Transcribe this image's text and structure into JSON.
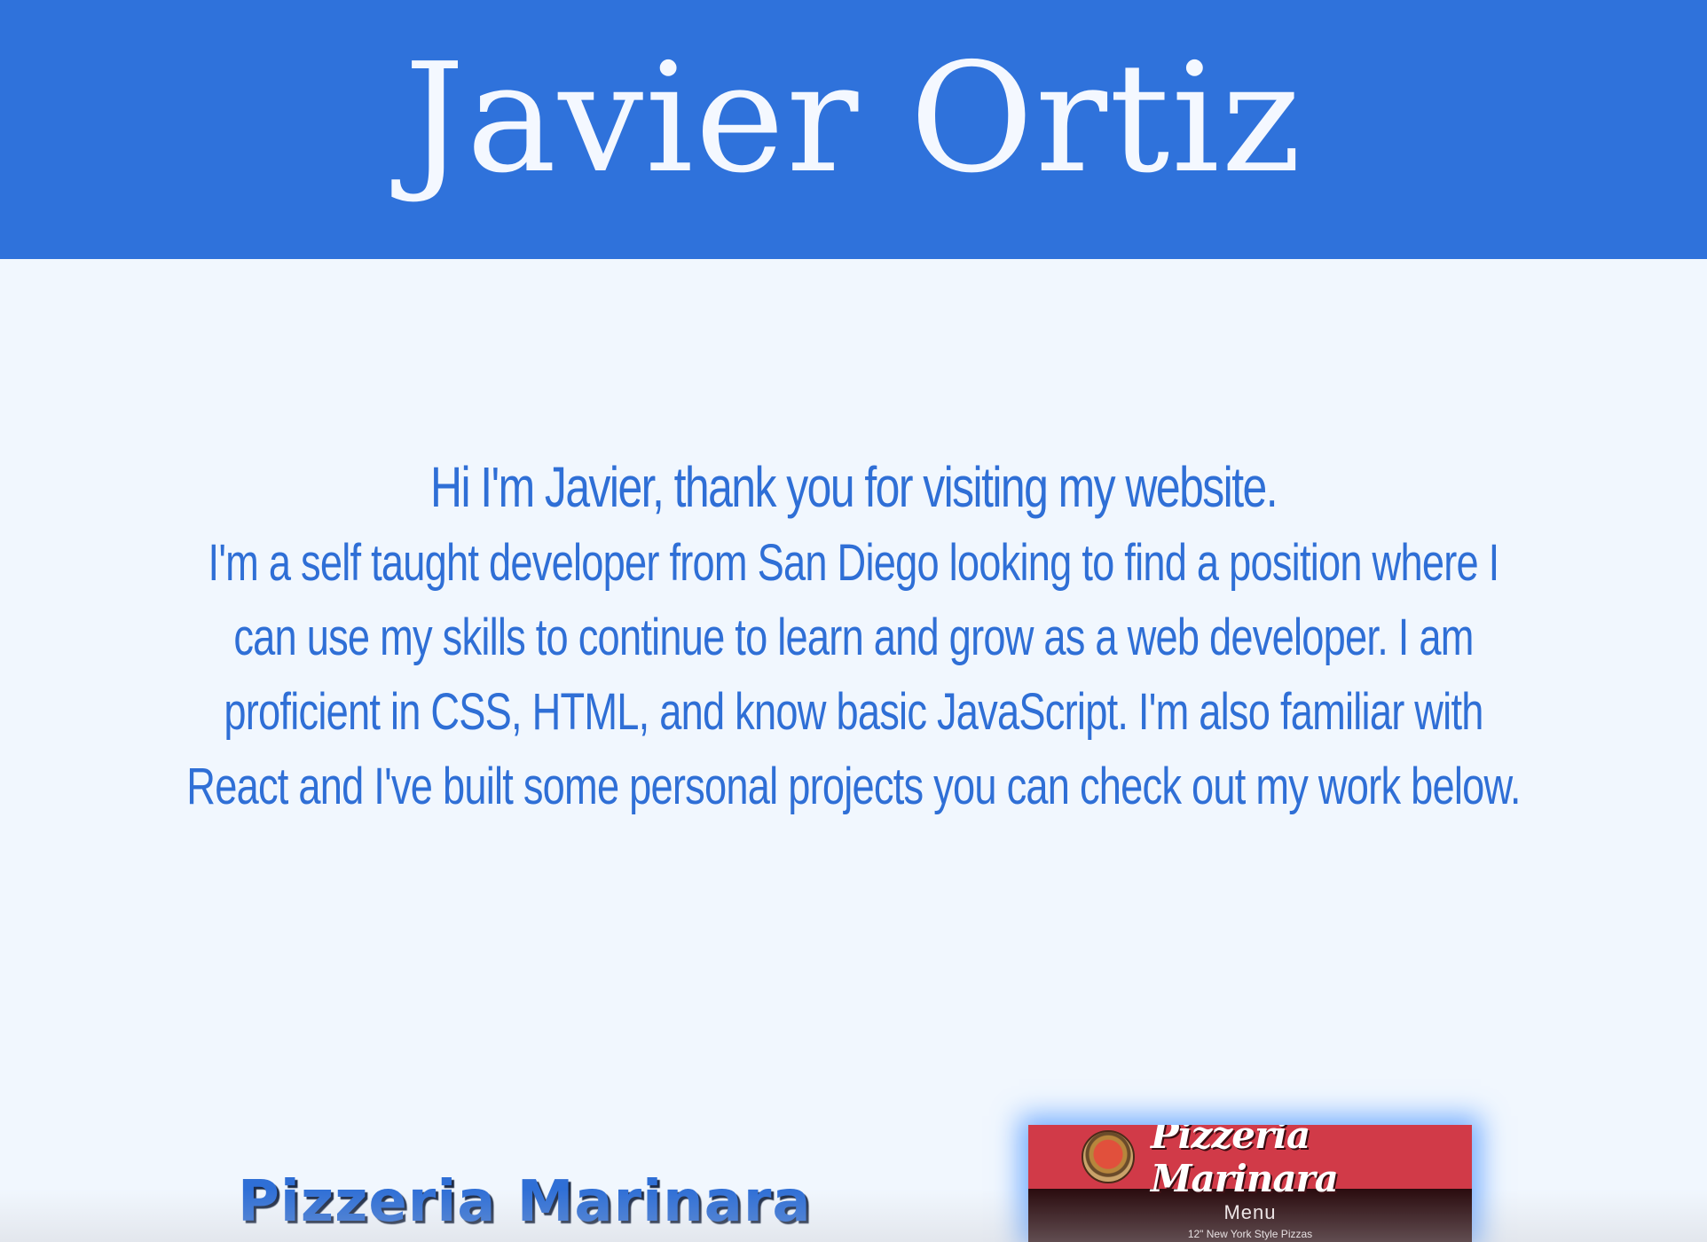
{
  "header": {
    "title": "Javier Ortiz"
  },
  "intro": {
    "greeting": "Hi I'm Javier, thank you for visiting my website.",
    "bio": "I'm a self taught developer from San Diego looking to find a position where I can use my skills to continue to learn and grow as a web developer. I am proficient in CSS, HTML, and know basic JavaScript. I'm also familiar with React and I've built some personal projects you can check out my work below."
  },
  "projects": [
    {
      "title": "Pizzeria Marinara",
      "preview": {
        "brand": "Pizzeria Marinara",
        "menu_title": "Menu",
        "menu_subtitle": "12\" New York Style Pizzas"
      }
    }
  ],
  "colors": {
    "header_bg": "#2f72db",
    "page_bg": "#f1f7fe",
    "accent_text": "#2f6fd6",
    "card_banner": "#d13a48",
    "card_bg": "#2a0b0e"
  }
}
